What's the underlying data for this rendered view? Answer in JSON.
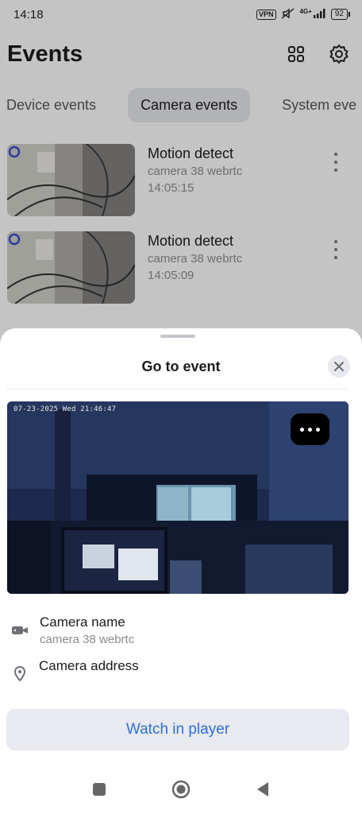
{
  "status_bar": {
    "time": "14:18",
    "vpn": "VPN",
    "network": "4G+",
    "battery": "92"
  },
  "header": {
    "title": "Events",
    "grid_icon": "grid-icon",
    "settings_icon": "gear-icon"
  },
  "tabs": [
    {
      "label": "Device events",
      "active": false
    },
    {
      "label": "Camera events",
      "active": true
    },
    {
      "label": "System eve",
      "active": false
    }
  ],
  "events": [
    {
      "title": "Motion detect",
      "camera": "camera 38 webrtc",
      "time": "14:05:15"
    },
    {
      "title": "Motion detect",
      "camera": "camera 38 webrtc",
      "time": "14:05:09"
    }
  ],
  "sheet": {
    "title": "Go to event",
    "preview_osd": "07-23-2025 Wed 21:46:47",
    "camera_name_label": "Camera name",
    "camera_name_value": "camera 38 webrtc",
    "camera_address_label": "Camera address",
    "watch_button": "Watch in player"
  },
  "colors": {
    "accent": "#2f6fdc",
    "sheet_bg": "#ffffff",
    "active_tab": "#dfe0e5"
  }
}
